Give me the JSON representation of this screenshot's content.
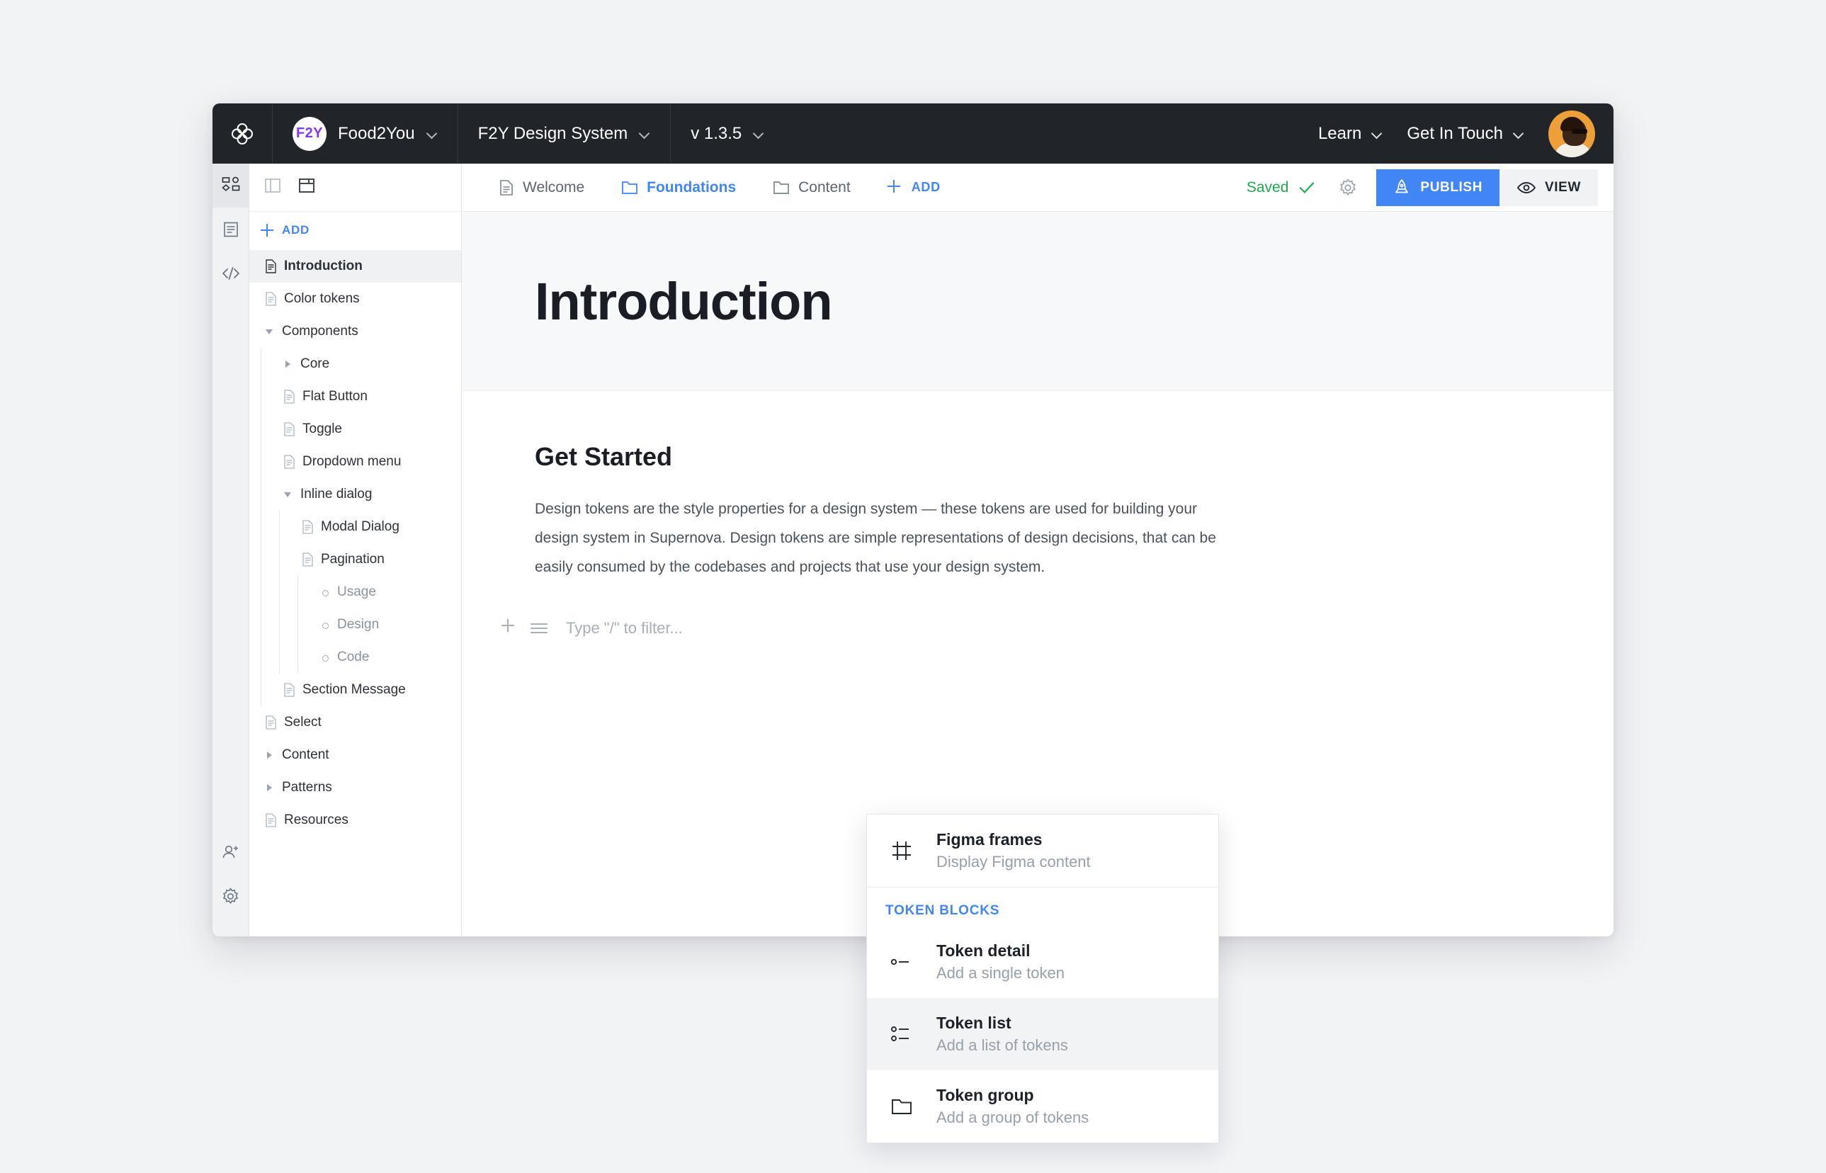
{
  "topbar": {
    "logo_icon": "supernova-logo-icon",
    "brand_initials": "F2Y",
    "workspace": "Food2You",
    "design_system": "F2Y Design System",
    "version": "v 1.3.5",
    "learn": "Learn",
    "get_in_touch": "Get In Touch",
    "avatar_alt": "user-avatar",
    "bg_color": "#212529",
    "brand_accent": "#8338f2"
  },
  "rail": {
    "items": [
      {
        "name": "design-tokens",
        "icon": "shapes-icon",
        "active": true
      },
      {
        "name": "documentation",
        "icon": "document-icon",
        "active": false
      },
      {
        "name": "code-integration",
        "icon": "code-icon",
        "active": false
      }
    ],
    "bottom_items": [
      {
        "name": "invite-member",
        "icon": "user-plus-icon"
      },
      {
        "name": "settings",
        "icon": "gear-icon"
      }
    ]
  },
  "panel": {
    "toolbar": [
      {
        "name": "toggle-side-panel",
        "icon": "panel-split-icon"
      },
      {
        "name": "toggle-page-layout",
        "icon": "panel-box-icon"
      }
    ],
    "add_label": "ADD",
    "tree": [
      {
        "label": "Introduction",
        "depth": 0,
        "marker": "doc",
        "selected": true,
        "muted": false
      },
      {
        "label": "Color tokens",
        "depth": 0,
        "marker": "doc",
        "selected": false,
        "muted": false
      },
      {
        "label": "Components",
        "depth": 0,
        "marker": "caret-open",
        "selected": false,
        "muted": false
      },
      {
        "label": "Core",
        "depth": 1,
        "marker": "caret",
        "selected": false,
        "muted": false
      },
      {
        "label": "Flat Button",
        "depth": 1,
        "marker": "doc",
        "selected": false,
        "muted": false
      },
      {
        "label": "Toggle",
        "depth": 1,
        "marker": "doc",
        "selected": false,
        "muted": false
      },
      {
        "label": "Dropdown menu",
        "depth": 1,
        "marker": "doc",
        "selected": false,
        "muted": false
      },
      {
        "label": "Inline dialog",
        "depth": 1,
        "marker": "caret-open",
        "selected": false,
        "muted": false
      },
      {
        "label": "Modal Dialog",
        "depth": 2,
        "marker": "doc",
        "selected": false,
        "muted": false
      },
      {
        "label": "Pagination",
        "depth": 2,
        "marker": "doc",
        "selected": false,
        "muted": false
      },
      {
        "label": "Usage",
        "depth": 3,
        "marker": "dot",
        "selected": false,
        "muted": true
      },
      {
        "label": "Design",
        "depth": 3,
        "marker": "dot",
        "selected": false,
        "muted": true
      },
      {
        "label": "Code",
        "depth": 3,
        "marker": "dot",
        "selected": false,
        "muted": true
      },
      {
        "label": "Section Message",
        "depth": 1,
        "marker": "doc",
        "selected": false,
        "muted": false
      },
      {
        "label": "Select",
        "depth": 0,
        "marker": "doc",
        "selected": false,
        "muted": false
      },
      {
        "label": "Content",
        "depth": 0,
        "marker": "caret",
        "selected": false,
        "muted": false
      },
      {
        "label": "Patterns",
        "depth": 0,
        "marker": "caret",
        "selected": false,
        "muted": false
      },
      {
        "label": "Resources",
        "depth": 0,
        "marker": "doc",
        "selected": false,
        "muted": false
      }
    ]
  },
  "subbar": {
    "tabs": [
      {
        "label": "Welcome",
        "icon": "document-icon",
        "active": false
      },
      {
        "label": "Foundations",
        "icon": "folder-icon",
        "active": true
      },
      {
        "label": "Content",
        "icon": "folder-icon",
        "active": false
      }
    ],
    "add_label": "ADD",
    "saved_label": "Saved",
    "settings_icon": "gear-icon",
    "publish_label": "PUBLISH",
    "publish_icon": "rocket-icon",
    "view_label": "VIEW",
    "view_icon": "eye-icon",
    "accent_color": "#4285f4",
    "saved_color": "#1faa4b"
  },
  "page": {
    "title": "Introduction",
    "section_heading": "Get Started",
    "paragraph": "Design tokens are the style properties for a design system — these tokens are used for building your design system in Supernova. Design tokens are simple representations of design decisions, that can be easily consumed by the codebases and projects that use your design system.",
    "filter_placeholder": "Type \"/\" to filter...",
    "block_add_icon": "plus-icon",
    "block_menu_icon": "menu-lines-icon"
  },
  "popup": {
    "primary": {
      "title": "Figma frames",
      "subtitle": "Display Figma content",
      "icon": "figma-frame-icon"
    },
    "section_label": "TOKEN BLOCKS",
    "items": [
      {
        "title": "Token detail",
        "subtitle": "Add a single token",
        "icon": "token-detail-icon",
        "hover": false
      },
      {
        "title": "Token list",
        "subtitle": "Add a list of tokens",
        "icon": "token-list-icon",
        "hover": true
      },
      {
        "title": "Token group",
        "subtitle": "Add a group of tokens",
        "icon": "folder-icon",
        "hover": false
      }
    ]
  }
}
